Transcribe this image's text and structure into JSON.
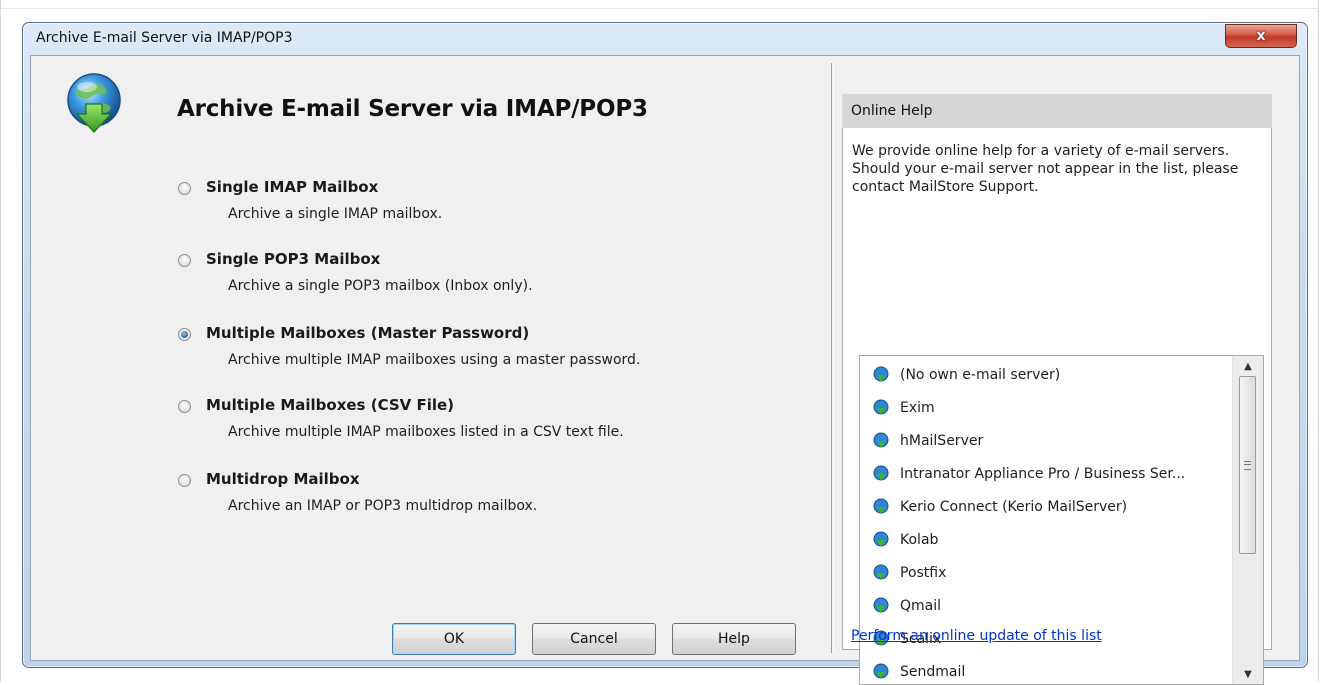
{
  "window": {
    "title": "Archive E-mail Server via IMAP/POP3",
    "close_label": "x"
  },
  "main": {
    "heading": "Archive E-mail Server via IMAP/POP3",
    "options": [
      {
        "title": "Single IMAP Mailbox",
        "description": "Archive a single IMAP mailbox.",
        "selected": false
      },
      {
        "title": "Single POP3 Mailbox",
        "description": "Archive a single POP3 mailbox (Inbox only).",
        "selected": false
      },
      {
        "title": "Multiple Mailboxes (Master Password)",
        "description": "Archive multiple IMAP mailboxes using a master password.",
        "selected": true
      },
      {
        "title": "Multiple Mailboxes (CSV File)",
        "description": "Archive multiple IMAP mailboxes listed in a CSV text file.",
        "selected": false
      },
      {
        "title": "Multidrop Mailbox",
        "description": "Archive an IMAP or POP3 multidrop mailbox.",
        "selected": false
      }
    ]
  },
  "buttons": {
    "ok": "OK",
    "cancel": "Cancel",
    "help": "Help"
  },
  "help_panel": {
    "header": "Online Help",
    "text": "We provide online help for a variety of e-mail servers. Should your e-mail server not appear in the list, please contact MailStore Support.",
    "servers": [
      "(No own e-mail server)",
      "Exim",
      "hMailServer",
      "Intranator Appliance Pro / Business Ser...",
      "Kerio Connect (Kerio MailServer)",
      "Kolab",
      "Postfix",
      "Qmail",
      "Scalix",
      "Sendmail"
    ],
    "link": "Perform an online update of this list"
  },
  "colors": {
    "link": "#0033cc",
    "title_gradient_top": "#dceaf6",
    "close_red": "#c0392b"
  }
}
